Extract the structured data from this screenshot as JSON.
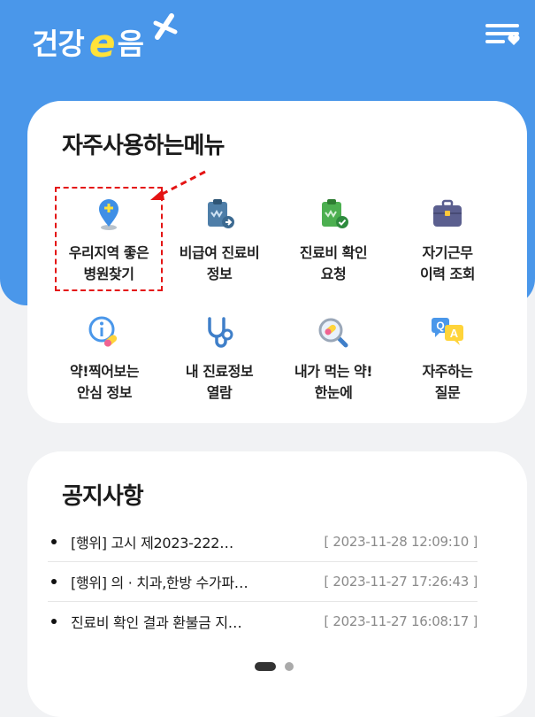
{
  "header": {
    "logo_part1": "건강",
    "logo_e": "e",
    "logo_part2": "음"
  },
  "quick_menu": {
    "title": "자주사용하는메뉴",
    "items": [
      {
        "label": "우리지역 좋은\n병원찾기",
        "icon": "location-pin-icon"
      },
      {
        "label": "비급여 진료비\n정보",
        "icon": "clipboard-arrow-icon"
      },
      {
        "label": "진료비 확인\n요청",
        "icon": "clipboard-check-icon"
      },
      {
        "label": "자기근무\n이력 조회",
        "icon": "briefcase-icon"
      },
      {
        "label": "약!찍어보는\n안심 정보",
        "icon": "info-pill-icon"
      },
      {
        "label": "내 진료정보\n열람",
        "icon": "stethoscope-icon"
      },
      {
        "label": "내가 먹는 약!\n한눈에",
        "icon": "magnifier-pill-icon"
      },
      {
        "label": "자주하는\n질문",
        "icon": "qa-bubble-icon"
      }
    ]
  },
  "notices": {
    "title": "공지사항",
    "items": [
      {
        "title": "[행위] 고시 제2023-222…",
        "date": "[ 2023-11-28 12:09:10 ]"
      },
      {
        "title": "[행위] 의 · 치과,한방 수가파…",
        "date": "[ 2023-11-27 17:26:43 ]"
      },
      {
        "title": "진료비 확인 결과 환불금 지…",
        "date": "[ 2023-11-27 16:08:17 ]"
      }
    ],
    "pager": {
      "pages": 2,
      "current": 1
    }
  },
  "colors": {
    "brand_blue": "#4a97ea",
    "logo_yellow": "#ffe23a",
    "highlight_red": "#e41414"
  }
}
